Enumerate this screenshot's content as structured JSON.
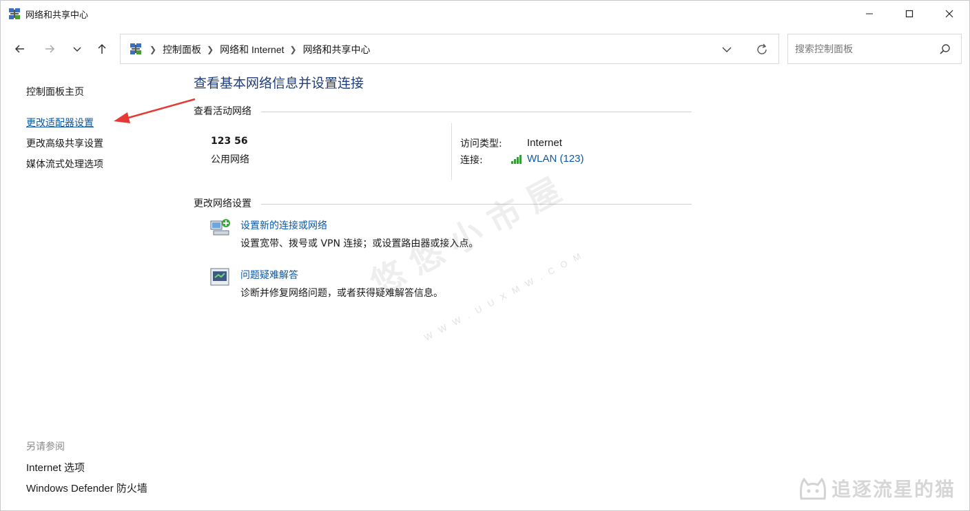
{
  "window": {
    "title": "网络和共享中心"
  },
  "address": {
    "crumbs": [
      "控制面板",
      "网络和 Internet",
      "网络和共享中心"
    ]
  },
  "search": {
    "placeholder": "搜索控制面板"
  },
  "sidebar": {
    "items": [
      {
        "label": "控制面板主页"
      },
      {
        "label": "更改适配器设置"
      },
      {
        "label": "更改高级共享设置"
      },
      {
        "label": "媒体流式处理选项"
      }
    ],
    "see_also_label": "另请参阅",
    "see_also": [
      {
        "label": "Internet 选项"
      },
      {
        "label": "Windows Defender 防火墙"
      }
    ]
  },
  "main": {
    "title": "查看基本网络信息并设置连接",
    "active_networks_heading": "查看活动网络",
    "network": {
      "name": "123 56",
      "kind": "公用网络",
      "access_type_label": "访问类型:",
      "access_type_value": "Internet",
      "connection_label": "连接:",
      "connection_value": "WLAN (123)"
    },
    "change_settings_heading": "更改网络设置",
    "tasks": [
      {
        "link": "设置新的连接或网络",
        "desc": "设置宽带、拨号或 VPN 连接；或设置路由器或接入点。"
      },
      {
        "link": "问题疑难解答",
        "desc": "诊断并修复网络问题，或者获得疑难解答信息。"
      }
    ]
  },
  "watermarks": {
    "center": "悠悠小市屋",
    "center_sub": "WWW.UUXMW.COM",
    "corner": "追逐流星的猫"
  },
  "colors": {
    "link": "#0c57a6",
    "title": "#1e3d7a",
    "annotation_arrow": "#e53935"
  }
}
